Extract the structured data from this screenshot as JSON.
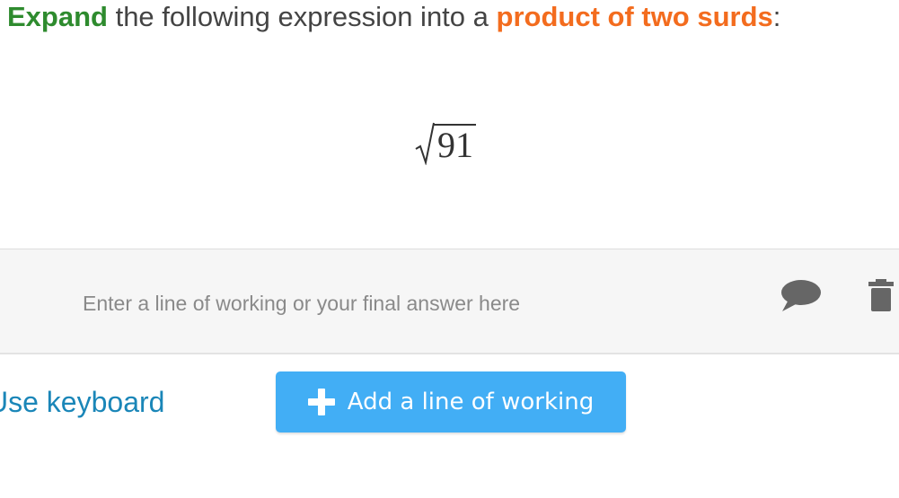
{
  "question": {
    "verb": "Expand",
    "middle": " the following expression into a ",
    "target": "product of two surds",
    "end": ":"
  },
  "expression": {
    "radicand": "91"
  },
  "working": {
    "placeholder": "Enter a line of working or your final answer here",
    "value": "",
    "comment_icon": "comment-icon",
    "delete_icon": "trash-icon"
  },
  "footer": {
    "use_keyboard_label": "Use keyboard",
    "add_line_label": "Add a line of working",
    "add_icon": "plus-icon"
  },
  "colors": {
    "green_keyword": "#2e8b2e",
    "orange_keyword": "#f36c1e",
    "link_blue": "#1a86b8",
    "button_blue": "#42aef5",
    "icon_grey": "#666666"
  }
}
